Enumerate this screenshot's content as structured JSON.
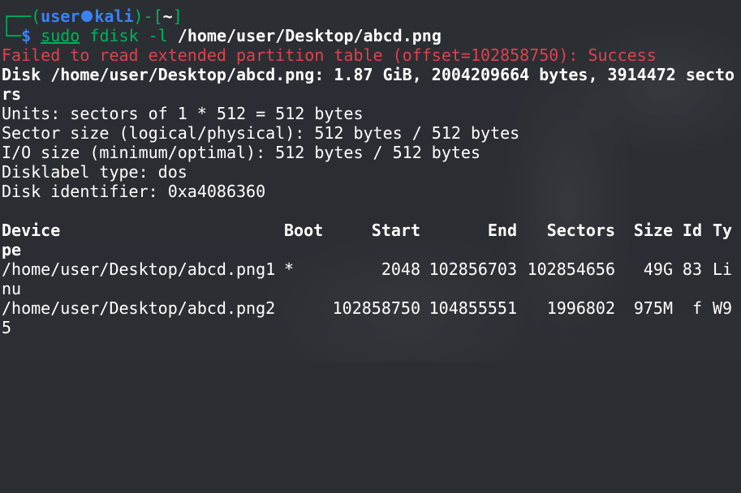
{
  "prompt": {
    "bracket_open": "┌──(",
    "user": "user",
    "host": "kali",
    "bracket_mid": ")-[",
    "path": "~",
    "bracket_close": "]",
    "prefix": "└─",
    "symbol": "$ ",
    "command_sudo": "sudo",
    "command_rest": " fdisk -l ",
    "command_arg": "/home/user/Desktop/abcd.png"
  },
  "output": {
    "error": "Failed to read extended partition table (offset=102858750): Success",
    "disk_line1": "Disk /home/user/Desktop/abcd.png: 1.87 GiB, 2004209664 bytes, 3914472 secto",
    "disk_line2": "rs",
    "units": "Units: sectors of 1 * 512 = 512 bytes",
    "sector_size": "Sector size (logical/physical): 512 bytes / 512 bytes",
    "io_size": "I/O size (minimum/optimal): 512 bytes / 512 bytes",
    "disklabel": "Disklabel type: dos",
    "identifier": "Disk identifier: 0xa4086360"
  },
  "table": {
    "headers": {
      "device": "Device",
      "boot": "Boot",
      "start": "Start",
      "end": "End",
      "sectors": "Sectors",
      "size": "Size",
      "id": "Id",
      "type": "Ty",
      "type_wrap": "pe"
    },
    "rows": [
      {
        "device": "/home/user/Desktop/abcd.png1",
        "boot": "*",
        "start": "2048",
        "end": "102856703",
        "sectors": "102854656",
        "size": "49G",
        "id": "83",
        "type": "Li",
        "type_wrap": "nu"
      },
      {
        "device": "/home/user/Desktop/abcd.png2",
        "boot": "",
        "start": "102858750",
        "end": "104855551",
        "sectors": "1996802",
        "size": "975M",
        "id": "f",
        "type": "W9",
        "type_wrap": "5"
      }
    ]
  }
}
